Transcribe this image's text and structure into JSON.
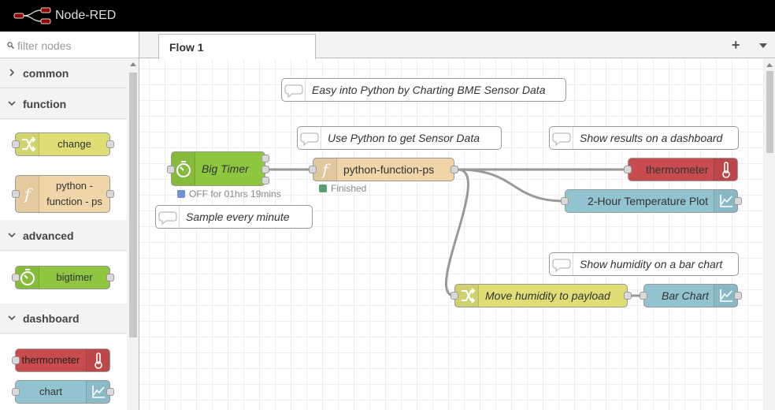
{
  "app": {
    "title": "Node-RED"
  },
  "palette": {
    "filter_placeholder": "filter nodes",
    "categories": [
      {
        "label": "common",
        "expanded": false
      },
      {
        "label": "function",
        "expanded": true
      },
      {
        "label": "advanced",
        "expanded": true
      },
      {
        "label": "dashboard",
        "expanded": true
      }
    ],
    "nodes": {
      "change": "change",
      "python_function": "python - function - ps",
      "bigtimer": "bigtimer",
      "thermometer": "thermometer",
      "chart": "chart"
    }
  },
  "workspace": {
    "tabs": [
      {
        "label": "Flow 1"
      }
    ],
    "add_tab_label": "+"
  },
  "flow": {
    "comments": {
      "title": "Easy into Python by Charting BME Sensor Data",
      "sensor": "Use Python to get Sensor Data",
      "results": "Show results on a dashboard",
      "sample": "Sample every minute",
      "humidity": "Show humidity on a bar chart"
    },
    "nodes": {
      "big_timer": "Big Timer",
      "python_function": "python-function-ps",
      "thermometer": "thermometer",
      "temp_plot": "2-Hour Temperature Plot",
      "move_humidity": "Move humidity to payload",
      "bar_chart": "Bar Chart"
    },
    "status": {
      "big_timer": "OFF for 01hrs 19mins",
      "python_function": "Finished"
    }
  },
  "colors": {
    "function_node": "#dede75",
    "python_node": "#f0d5a8",
    "timer_node": "#8ec63f",
    "gauge_node": "#c84c4f",
    "chart_node": "#91c4d0",
    "status_blue": "#6f8fd6",
    "status_green": "#5a9f71",
    "header": "#000000"
  }
}
